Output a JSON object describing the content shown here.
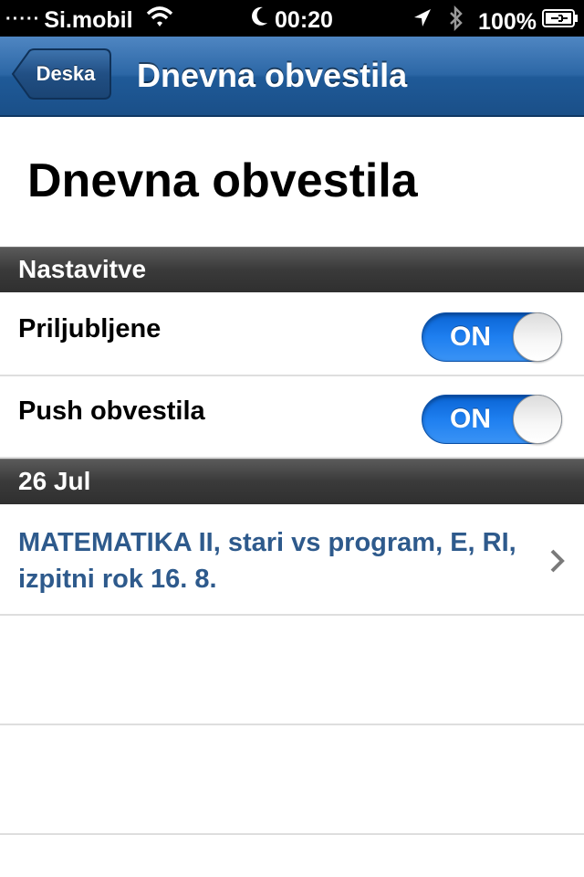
{
  "status_bar": {
    "signal_dots": "·····",
    "carrier": "Si.mobil",
    "time": "00:20",
    "battery_text": "100%",
    "icons": [
      "wifi-icon",
      "moon-icon",
      "location-arrow-icon",
      "bluetooth-icon",
      "battery-charging-icon"
    ]
  },
  "navbar": {
    "back_label": "Deska",
    "title": "Dnevna obvestila",
    "color": "#2c67a6"
  },
  "page": {
    "title": "Dnevna obvestila"
  },
  "settings_section": {
    "header": "Nastavitve",
    "rows": [
      {
        "label": "Priljubljene",
        "toggle_text": "ON",
        "toggle_on": true
      },
      {
        "label": "Push obvestila",
        "toggle_text": "ON",
        "toggle_on": true
      }
    ]
  },
  "date_section": {
    "header": "26 Jul",
    "items": [
      {
        "title": "MATEMATIKA II, stari vs program, E, RI, izpitni rok 16. 8."
      }
    ]
  },
  "colors": {
    "toggle_blue": "#1e7ff0",
    "link_text": "#2e5a8c",
    "section_header": "#3a3a3a"
  }
}
